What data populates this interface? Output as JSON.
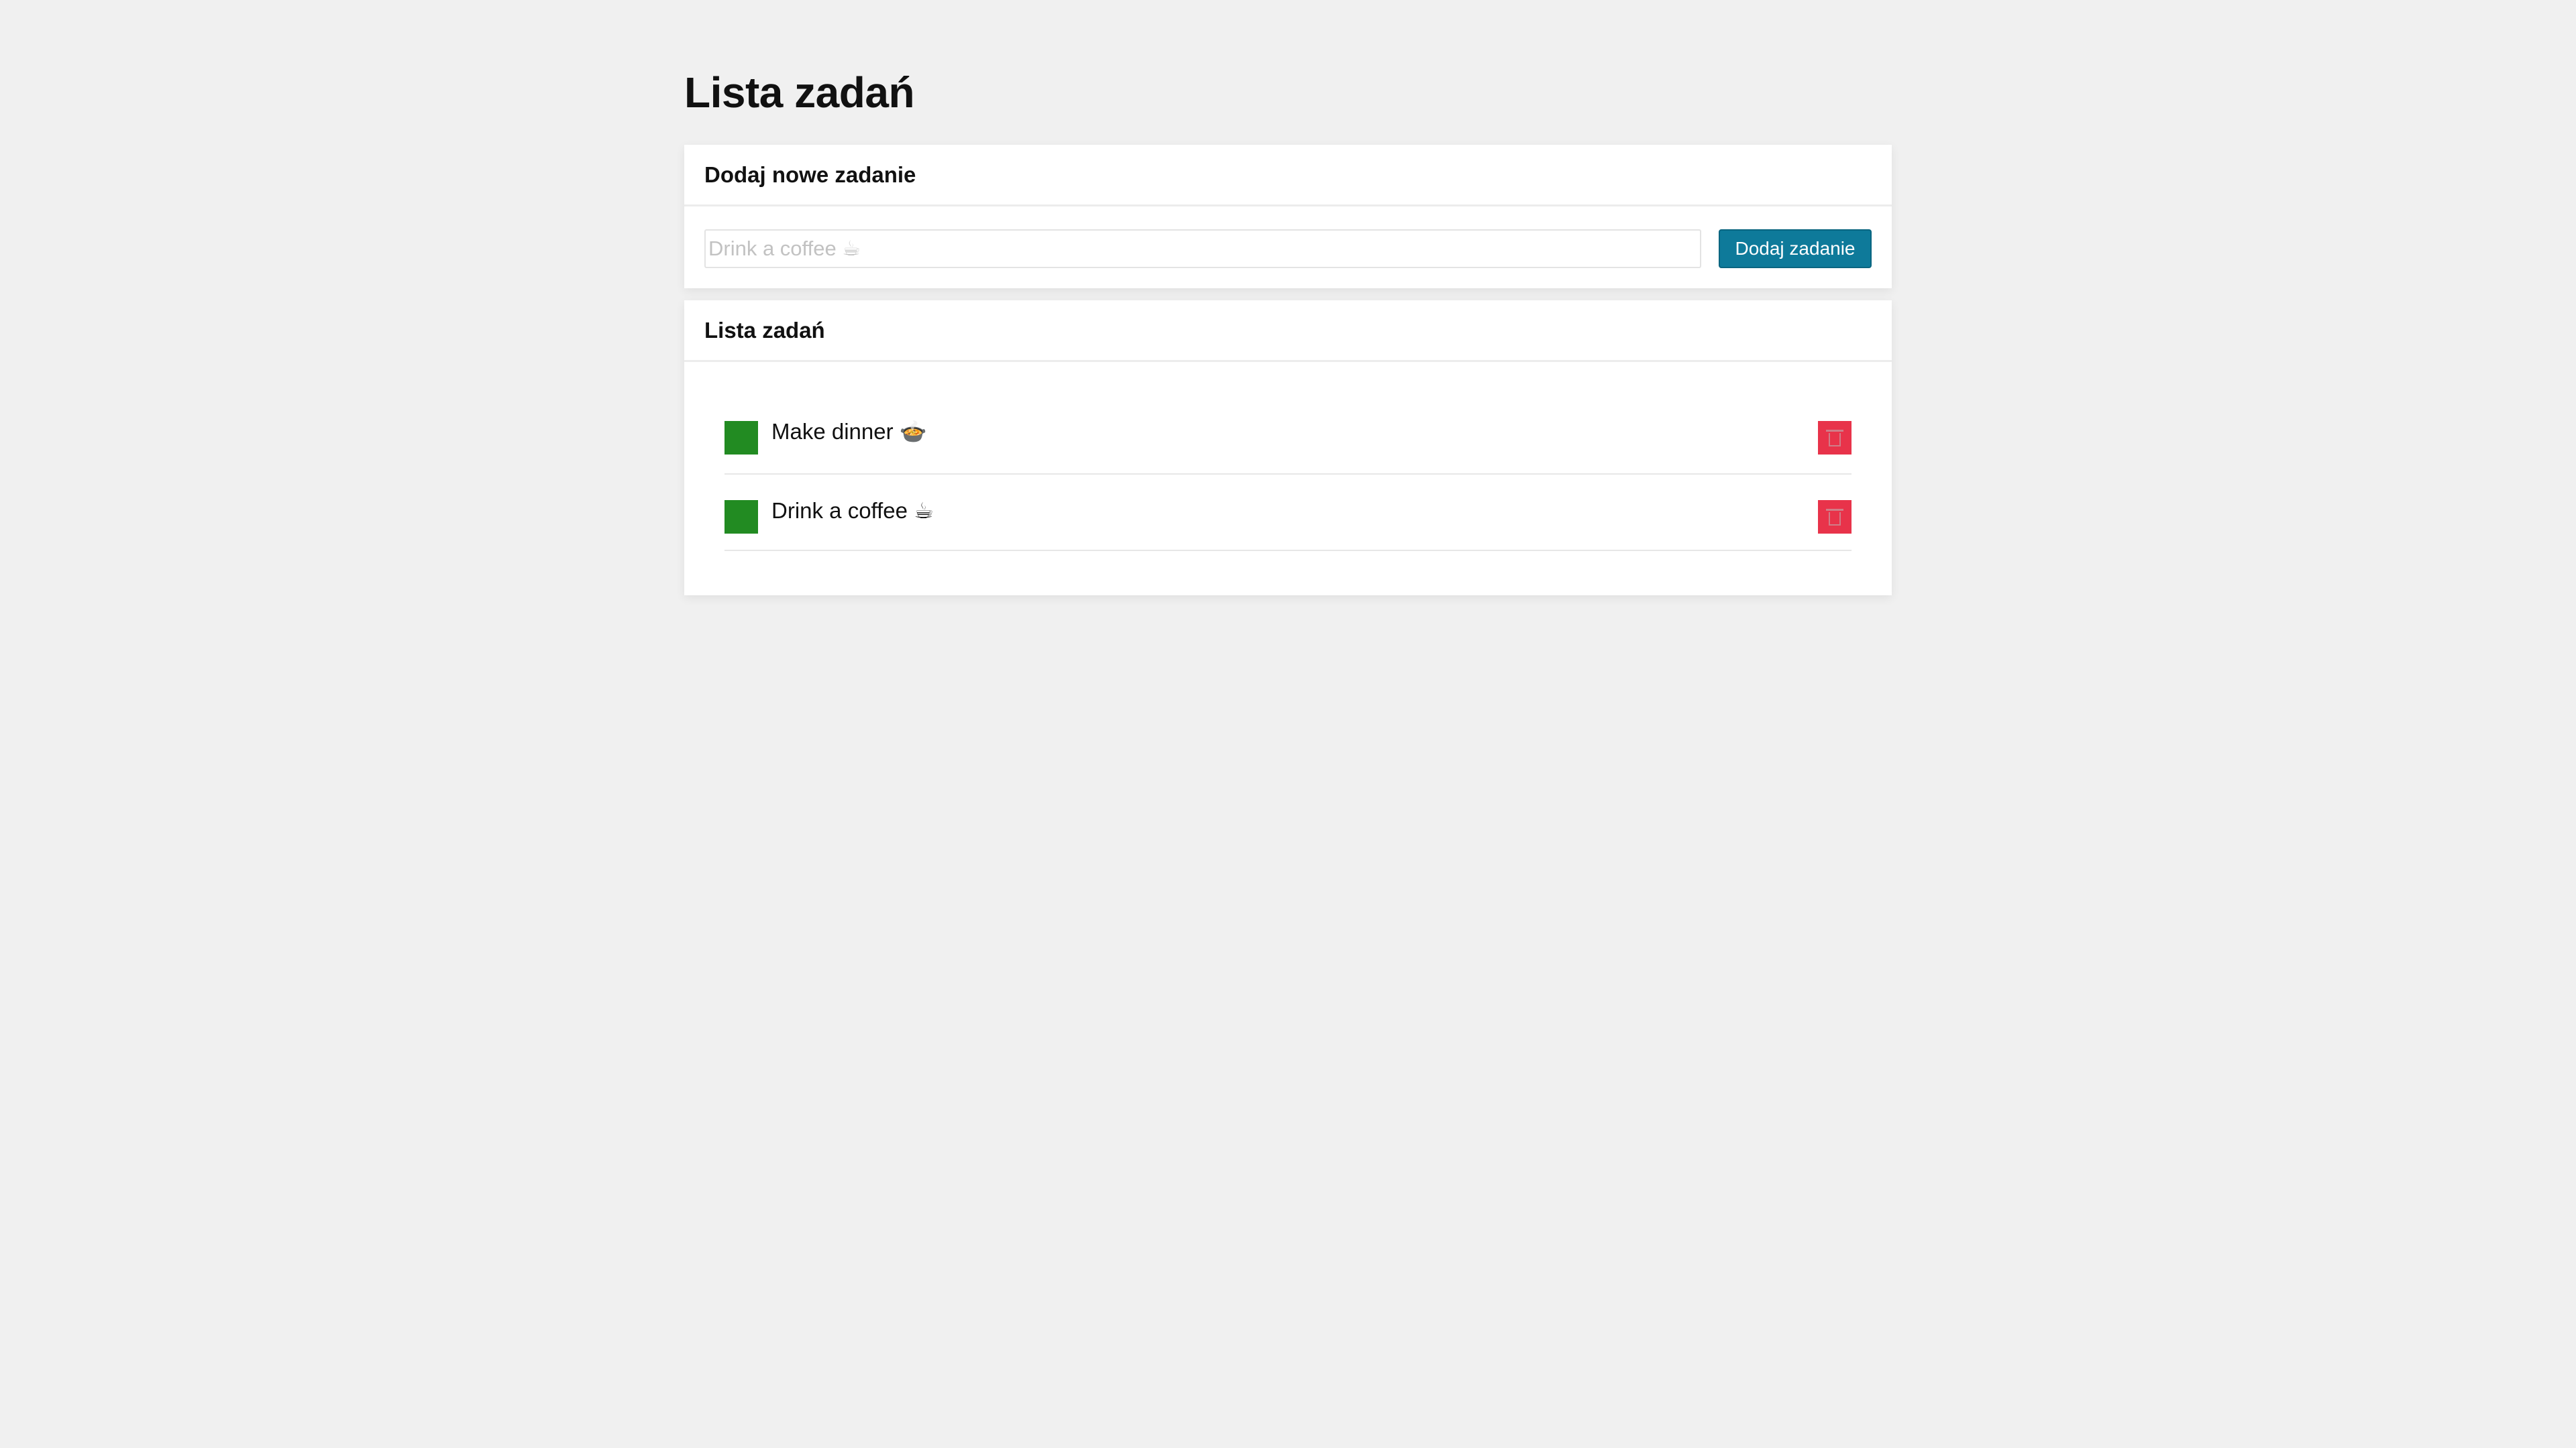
{
  "page": {
    "title": "Lista zadań"
  },
  "add_panel": {
    "heading": "Dodaj nowe zadanie",
    "input_placeholder": "Drink a coffee ☕",
    "input_value": "",
    "add_button_label": "Dodaj zadanie"
  },
  "list_panel": {
    "heading": "Lista zadań",
    "tasks": [
      {
        "label": "Make dinner 🍲",
        "checkbox_icon": "green-square-checkbox",
        "delete_icon": "trash-icon"
      },
      {
        "label": "Drink a coffee ☕",
        "checkbox_icon": "green-square-checkbox",
        "delete_icon": "trash-icon"
      }
    ]
  },
  "colors": {
    "background": "#f0f0f0",
    "accent_button": "#0e7a9a",
    "checkbox": "#228b22",
    "delete": "#e8334a"
  }
}
